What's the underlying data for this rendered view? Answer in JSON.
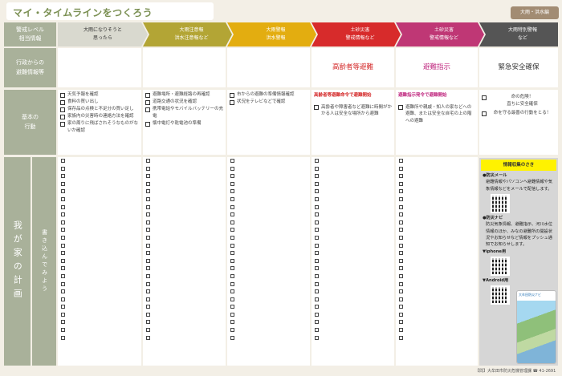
{
  "title": "マイ・タイムラインをつくろう",
  "badge": "大雨・洪水編",
  "row_headers": {
    "warning_level": "警戒レベル\n相当情報",
    "admin_info": "行政からの\n避難情報等",
    "basic_action": "基本の\n行動",
    "family_plan": "我が家の計画",
    "write_in": "書き込んでみよう"
  },
  "stages": [
    {
      "label": "大雨になりそうと\n思ったら",
      "color": "#d9d9cf",
      "text_color": "#333333"
    },
    {
      "label": "大雨注意報\n洪水注意報など",
      "color": "#b3a535",
      "text_color": "#ffffff"
    },
    {
      "label": "大雨警報\n洪水警報",
      "color": "#e3ad10",
      "text_color": "#ffffff"
    },
    {
      "label": "土砂災害\n警戒情報など",
      "color": "#d72b2b",
      "text_color": "#ffffff"
    },
    {
      "label": "土砂災害\n警戒情報など",
      "color": "#bf3775",
      "text_color": "#ffffff"
    },
    {
      "label": "大雨特別警報\nなど",
      "color": "#555555",
      "text_color": "#ffffff"
    }
  ],
  "admin_info": [
    {
      "text": "",
      "color": "#333333"
    },
    {
      "text": "",
      "color": "#333333"
    },
    {
      "text": "",
      "color": "#333333"
    },
    {
      "text": "高齢者等避難",
      "color": "#d42a2a"
    },
    {
      "text": "避難指示",
      "color": "#c02a80"
    },
    {
      "text": "緊急安全確保",
      "color": "#333333"
    }
  ],
  "basic_actions": [
    {
      "heading": "",
      "items": [
        "天気予報を確認",
        "食料の買い出し",
        "保存品の点検と不足分の買い足し",
        "家族内の災害時の連絡方法を確認",
        "家の周りに飛ばされそうなものがないか確認"
      ]
    },
    {
      "heading": "",
      "items": [
        "避難場所・避難経路の再確認",
        "道路交通の状況を確認",
        "携帯電話やモバイルバッテリーの充電",
        "懐中電灯や乾電池の準備"
      ]
    },
    {
      "heading": "",
      "items": [
        "市からの避難の準備情報確認",
        "状況をテレビなどで確認"
      ]
    },
    {
      "heading": "高齢者等避難命令で避難開始",
      "items": [
        "高齢者や障害者など避難に時間がかかる人は安全な場所から避難"
      ]
    },
    {
      "heading": "避難指示発令で避難開始",
      "items": [
        "避難所や親戚・知人の家などへの避難、または安全な自宅の上の階への避難"
      ]
    },
    {
      "heading": "",
      "items": [
        "命の危険！\n直ちに安全確保",
        "命を守る最善の行動をとる！"
      ]
    }
  ],
  "plan_box_counts": [
    24,
    24,
    24,
    24,
    24
  ],
  "info_box": {
    "title": "情報収集のさき",
    "sections": [
      {
        "label": "●防災メール",
        "text": "避難情報やパソコンへ避難情報や気象情報などをメールで配信します。"
      },
      {
        "label": "●防災ナビ",
        "text": "防災気象情報、避難指示、河川水位情報のほか、みなの避難所の開設状況やお知らせなど情報をプッシュ通知でお知らせします。"
      }
    ],
    "iphone_label": "▼iphone用",
    "android_label": "▼Android用",
    "app_label": "大牟田防災ナビ"
  },
  "footer": "【問】大牟田市防災危機管理課 ☎ 41-2691"
}
